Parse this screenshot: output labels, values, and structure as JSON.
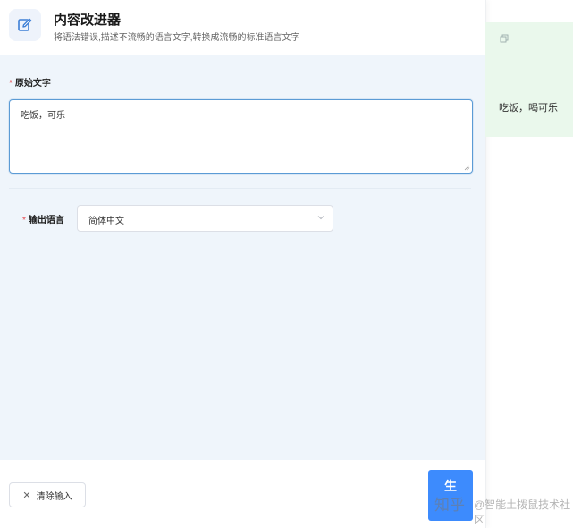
{
  "header": {
    "title": "内容改进器",
    "subtitle": "将语法错误,描述不流畅的语言文字,转换成流畅的标准语言文字",
    "icon": "edit-icon"
  },
  "form": {
    "source_label": "原始文字",
    "source_value": "吃饭，可乐",
    "language_label": "输出语言",
    "language_value": "简体中文",
    "required_mark": "*"
  },
  "footer": {
    "clear_label": "清除输入",
    "generate_label": "生"
  },
  "output": {
    "text": "吃饭，喝可乐",
    "copy_icon": "copy-icon"
  },
  "watermark": {
    "brand": "知乎",
    "text": "@智能土拨鼠技术社区"
  },
  "colors": {
    "accent": "#3d8bfd",
    "form_bg": "#eff5fb",
    "output_bg": "#eaf8ec",
    "required": "#e5484d"
  }
}
